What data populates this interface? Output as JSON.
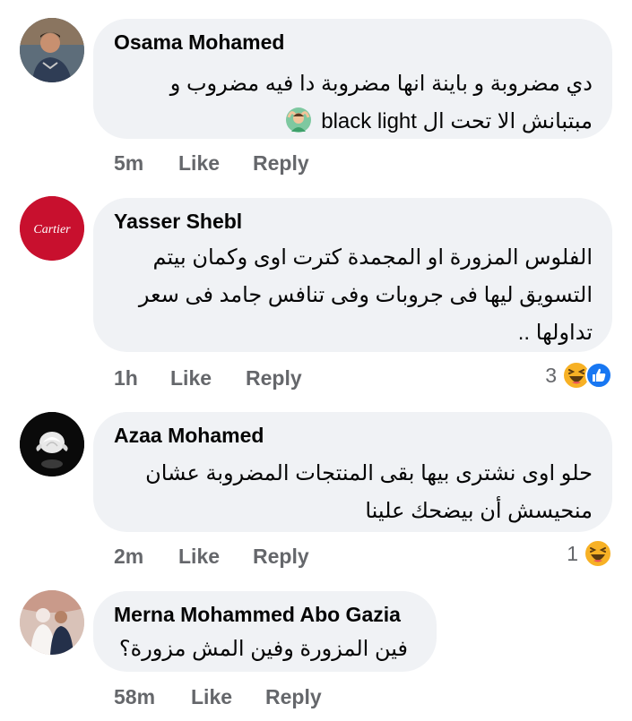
{
  "comments": [
    {
      "author": "Osama Mohamed",
      "lines": [
        "دي مضروبة و باينة انها مضروبة دا فيه مضروب و",
        "مبتبانش الا تحت ال black light"
      ],
      "emoji_in_text": "person-gesturing-ok-emoji",
      "time": "5m",
      "like_label": "Like",
      "reply_label": "Reply",
      "reaction_count": "",
      "reactions": []
    },
    {
      "author": "Yasser Shebl",
      "lines": [
        "الفلوس المزورة او المجمدة كترت اوى وكمان بيتم",
        "التسويق ليها فى جروبات وفى تنافس جامد فى سعر",
        "تداولها .."
      ],
      "avatar_text": "Cartier",
      "time": "1h",
      "like_label": "Like",
      "reply_label": "Reply",
      "reaction_count": "3",
      "reactions": [
        "haha-reaction-icon",
        "like-reaction-icon"
      ]
    },
    {
      "author": "Azaa Mohamed",
      "lines": [
        "حلو اوى نشترى بيها بقى المنتجات المضروبة عشان",
        "منحيسش أن بيضحك علينا"
      ],
      "time": "2m",
      "like_label": "Like",
      "reply_label": "Reply",
      "reaction_count": "1",
      "reactions": [
        "haha-reaction-icon"
      ]
    },
    {
      "author": "Merna Mohammed Abo Gazia",
      "lines": [
        "فين المزورة وفين المش مزورة؟"
      ],
      "time": "58m",
      "like_label": "Like",
      "reply_label": "Reply",
      "reaction_count": "",
      "reactions": []
    }
  ],
  "colors": {
    "bubble": "#f0f2f5",
    "meta_text": "#65676b",
    "like_blue": "#1877f2",
    "haha_yellow": "#f7b125",
    "cartier_red": "#c8102e"
  }
}
